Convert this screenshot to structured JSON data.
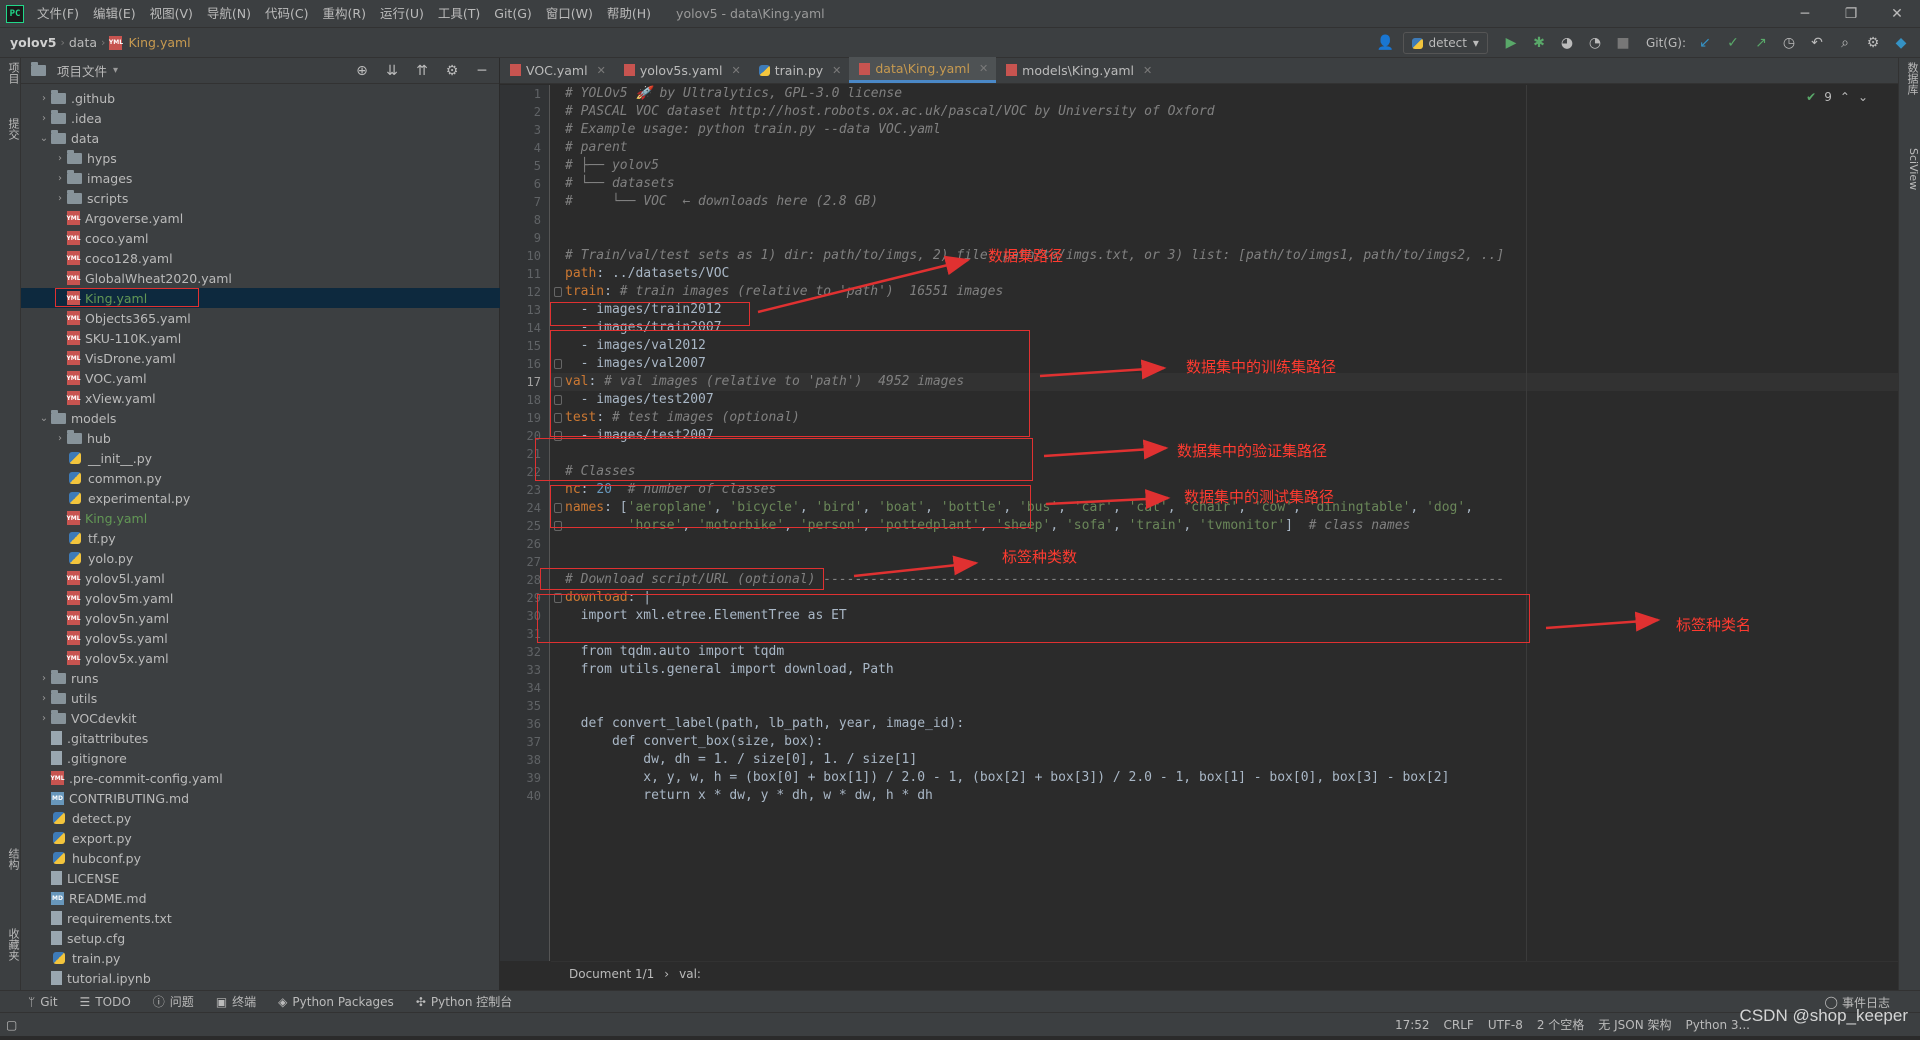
{
  "menu": {
    "logo": "PC",
    "items": [
      "文件(F)",
      "编辑(E)",
      "视图(V)",
      "导航(N)",
      "代码(C)",
      "重构(R)",
      "运行(U)",
      "工具(T)",
      "Git(G)",
      "窗口(W)",
      "帮助(H)"
    ],
    "window_title": "yolov5 - data\\King.yaml"
  },
  "breadcrumbs": {
    "project": "yolov5",
    "folder": "data",
    "file": "King.yaml"
  },
  "toolbar": {
    "run_config": "detect",
    "git_label": "Git(G):"
  },
  "project_panel": {
    "title": "项目文件",
    "tree": [
      {
        "label": ".github",
        "type": "folder",
        "depth": 1,
        "arrow": "›"
      },
      {
        "label": ".idea",
        "type": "folder",
        "depth": 1,
        "arrow": "›"
      },
      {
        "label": "data",
        "type": "folder",
        "depth": 1,
        "arrow": "⌄"
      },
      {
        "label": "hyps",
        "type": "folder",
        "depth": 2,
        "arrow": "›"
      },
      {
        "label": "images",
        "type": "folder",
        "depth": 2,
        "arrow": "›"
      },
      {
        "label": "scripts",
        "type": "folder",
        "depth": 2,
        "arrow": "›"
      },
      {
        "label": "Argoverse.yaml",
        "type": "yaml",
        "depth": 2
      },
      {
        "label": "coco.yaml",
        "type": "yaml",
        "depth": 2
      },
      {
        "label": "coco128.yaml",
        "type": "yaml",
        "depth": 2
      },
      {
        "label": "GlobalWheat2020.yaml",
        "type": "yaml",
        "depth": 2
      },
      {
        "label": "King.yaml",
        "type": "yaml",
        "depth": 2,
        "selected": true,
        "green": true
      },
      {
        "label": "Objects365.yaml",
        "type": "yaml",
        "depth": 2
      },
      {
        "label": "SKU-110K.yaml",
        "type": "yaml",
        "depth": 2
      },
      {
        "label": "VisDrone.yaml",
        "type": "yaml",
        "depth": 2
      },
      {
        "label": "VOC.yaml",
        "type": "yaml",
        "depth": 2
      },
      {
        "label": "xView.yaml",
        "type": "yaml",
        "depth": 2
      },
      {
        "label": "models",
        "type": "folder",
        "depth": 1,
        "arrow": "⌄"
      },
      {
        "label": "hub",
        "type": "folder",
        "depth": 2,
        "arrow": "›"
      },
      {
        "label": "__init__.py",
        "type": "py",
        "depth": 2
      },
      {
        "label": "common.py",
        "type": "py",
        "depth": 2
      },
      {
        "label": "experimental.py",
        "type": "py",
        "depth": 2
      },
      {
        "label": "King.yaml",
        "type": "yaml",
        "depth": 2,
        "green": true
      },
      {
        "label": "tf.py",
        "type": "py",
        "depth": 2
      },
      {
        "label": "yolo.py",
        "type": "py",
        "depth": 2
      },
      {
        "label": "yolov5l.yaml",
        "type": "yaml",
        "depth": 2
      },
      {
        "label": "yolov5m.yaml",
        "type": "yaml",
        "depth": 2
      },
      {
        "label": "yolov5n.yaml",
        "type": "yaml",
        "depth": 2
      },
      {
        "label": "yolov5s.yaml",
        "type": "yaml",
        "depth": 2
      },
      {
        "label": "yolov5x.yaml",
        "type": "yaml",
        "depth": 2
      },
      {
        "label": "runs",
        "type": "folder",
        "depth": 1,
        "arrow": "›"
      },
      {
        "label": "utils",
        "type": "folder",
        "depth": 1,
        "arrow": "›"
      },
      {
        "label": "VOCdevkit",
        "type": "folder",
        "depth": 1,
        "arrow": "›"
      },
      {
        "label": ".gitattributes",
        "type": "text",
        "depth": 1
      },
      {
        "label": ".gitignore",
        "type": "text",
        "depth": 1
      },
      {
        "label": ".pre-commit-config.yaml",
        "type": "yaml",
        "depth": 1
      },
      {
        "label": "CONTRIBUTING.md",
        "type": "md",
        "depth": 1
      },
      {
        "label": "detect.py",
        "type": "py",
        "depth": 1
      },
      {
        "label": "export.py",
        "type": "py",
        "depth": 1
      },
      {
        "label": "hubconf.py",
        "type": "py",
        "depth": 1
      },
      {
        "label": "LICENSE",
        "type": "text",
        "depth": 1
      },
      {
        "label": "README.md",
        "type": "md",
        "depth": 1
      },
      {
        "label": "requirements.txt",
        "type": "text",
        "depth": 1
      },
      {
        "label": "setup.cfg",
        "type": "text",
        "depth": 1
      },
      {
        "label": "train.py",
        "type": "py",
        "depth": 1
      },
      {
        "label": "tutorial.ipynb",
        "type": "text",
        "depth": 1
      }
    ]
  },
  "tabs": [
    {
      "label": "VOC.yaml",
      "type": "yaml"
    },
    {
      "label": "yolov5s.yaml",
      "type": "yaml"
    },
    {
      "label": "train.py",
      "type": "py"
    },
    {
      "label": "data\\King.yaml",
      "type": "yaml",
      "active": true
    },
    {
      "label": "models\\King.yaml",
      "type": "yaml"
    }
  ],
  "editor": {
    "current_line": 17,
    "inspection_count": "9",
    "lines": [
      [
        [
          "c-com",
          "# YOLOv5 🚀 by Ultralytics, GPL-3.0 license"
        ]
      ],
      [
        [
          "c-com",
          "# PASCAL VOC dataset http://host.robots.ox.ac.uk/pascal/VOC by University of Oxford"
        ]
      ],
      [
        [
          "c-com",
          "# Example usage: python train.py --data VOC.yaml"
        ]
      ],
      [
        [
          "c-com",
          "# parent"
        ]
      ],
      [
        [
          "c-com",
          "# ├── yolov5"
        ]
      ],
      [
        [
          "c-com",
          "# └── datasets"
        ]
      ],
      [
        [
          "c-com",
          "#     └── VOC  ← downloads here (2.8 GB)"
        ]
      ],
      [],
      [],
      [
        [
          "c-com",
          "# Train/val/test sets as 1) dir: path/to/imgs, 2) file: path/to/imgs.txt, or 3) list: [path/to/imgs1, path/to/imgs2, ..]"
        ]
      ],
      [
        [
          "c-key",
          "path"
        ],
        [
          "c-plain",
          ": ../datasets/VOC"
        ]
      ],
      [
        [
          "c-key",
          "train"
        ],
        [
          "c-plain",
          ": "
        ],
        [
          "c-com",
          "# train images (relative to 'path')  16551 images"
        ]
      ],
      [
        [
          "c-plain",
          "  - images/train2012"
        ]
      ],
      [
        [
          "c-plain",
          "  - images/train2007"
        ]
      ],
      [
        [
          "c-plain",
          "  - images/val2012"
        ]
      ],
      [
        [
          "c-plain",
          "  - images/val2007"
        ]
      ],
      [
        [
          "c-key",
          "val"
        ],
        [
          "c-plain",
          ": "
        ],
        [
          "c-com",
          "# val images (relative to 'path')  4952 images"
        ]
      ],
      [
        [
          "c-plain",
          "  - images/test2007"
        ]
      ],
      [
        [
          "c-key",
          "test"
        ],
        [
          "c-plain",
          ": "
        ],
        [
          "c-com",
          "# test images (optional)"
        ]
      ],
      [
        [
          "c-plain",
          "  - images/test2007"
        ]
      ],
      [],
      [
        [
          "c-com",
          "# Classes"
        ]
      ],
      [
        [
          "c-key",
          "nc"
        ],
        [
          "c-plain",
          ": "
        ],
        [
          "c-num",
          "20"
        ],
        [
          "c-plain",
          "  "
        ],
        [
          "c-com",
          "# number of classes"
        ]
      ],
      [
        [
          "c-key",
          "names"
        ],
        [
          "c-plain",
          ": ["
        ],
        [
          "c-str",
          "'aeroplane'"
        ],
        [
          "c-plain",
          ", "
        ],
        [
          "c-str",
          "'bicycle'"
        ],
        [
          "c-plain",
          ", "
        ],
        [
          "c-str",
          "'bird'"
        ],
        [
          "c-plain",
          ", "
        ],
        [
          "c-str",
          "'boat'"
        ],
        [
          "c-plain",
          ", "
        ],
        [
          "c-str",
          "'bottle'"
        ],
        [
          "c-plain",
          ", "
        ],
        [
          "c-str",
          "'bus'"
        ],
        [
          "c-plain",
          ", "
        ],
        [
          "c-str",
          "'car'"
        ],
        [
          "c-plain",
          ", "
        ],
        [
          "c-str",
          "'cat'"
        ],
        [
          "c-plain",
          ", "
        ],
        [
          "c-str",
          "'chair'"
        ],
        [
          "c-plain",
          ", "
        ],
        [
          "c-str",
          "'cow'"
        ],
        [
          "c-plain",
          ", "
        ],
        [
          "c-str",
          "'diningtable'"
        ],
        [
          "c-plain",
          ", "
        ],
        [
          "c-str",
          "'dog'"
        ],
        [
          "c-plain",
          ","
        ]
      ],
      [
        [
          "c-plain",
          "        "
        ],
        [
          "c-str",
          "'horse'"
        ],
        [
          "c-plain",
          ", "
        ],
        [
          "c-str",
          "'motorbike'"
        ],
        [
          "c-plain",
          ", "
        ],
        [
          "c-str",
          "'person'"
        ],
        [
          "c-plain",
          ", "
        ],
        [
          "c-str",
          "'pottedplant'"
        ],
        [
          "c-plain",
          ", "
        ],
        [
          "c-str",
          "'sheep'"
        ],
        [
          "c-plain",
          ", "
        ],
        [
          "c-str",
          "'sofa'"
        ],
        [
          "c-plain",
          ", "
        ],
        [
          "c-str",
          "'train'"
        ],
        [
          "c-plain",
          ", "
        ],
        [
          "c-str",
          "'tvmonitor'"
        ],
        [
          "c-plain",
          "]  "
        ],
        [
          "c-com",
          "# class names"
        ]
      ],
      [],
      [],
      [
        [
          "c-com",
          "# Download script/URL (optional) ---------------------------------------------------------------------------------------"
        ]
      ],
      [
        [
          "c-key",
          "download"
        ],
        [
          "c-plain",
          ": |"
        ]
      ],
      [
        [
          "c-plain",
          "  import xml.etree.ElementTree as ET"
        ]
      ],
      [],
      [
        [
          "c-plain",
          "  from tqdm.auto import tqdm"
        ]
      ],
      [
        [
          "c-plain",
          "  from utils.general import download, Path"
        ]
      ],
      [],
      [],
      [
        [
          "c-plain",
          "  def convert_label(path, lb_path, year, image_id):"
        ]
      ],
      [
        [
          "c-plain",
          "      def convert_box(size, box):"
        ]
      ],
      [
        [
          "c-plain",
          "          dw, dh = 1. / size[0], 1. / size[1]"
        ]
      ],
      [
        [
          "c-plain",
          "          x, y, w, h = (box[0] + box[1]) / 2.0 - 1, (box[2] + box[3]) / 2.0 - 1, box[1] - box[0], box[3] - box[2]"
        ]
      ],
      [
        [
          "c-plain",
          "          return x * dw, y * dh, w * dw, h * dh"
        ]
      ]
    ]
  },
  "editor_crumbs": {
    "doc": "Document 1/1",
    "sep": "›",
    "key": "val:"
  },
  "annotations": {
    "dataset_path": "数据集路径",
    "train_path": "数据集中的训练集路径",
    "val_path": "数据集中的验证集路径",
    "test_path": "数据集中的测试集路径",
    "nc": "标签种类数",
    "names": "标签种类名"
  },
  "bottom_tools": [
    "Git",
    "TODO",
    "问题",
    "终端",
    "Python Packages",
    "Python 控制台"
  ],
  "event_log": "事件日志",
  "status": {
    "position": "17:52",
    "line_sep": "CRLF",
    "encoding": "UTF-8",
    "indent": "2 个空格",
    "schema": "无 JSON 架构",
    "interpreter": "Python 3..."
  },
  "watermark": "CSDN @shop_keeper",
  "stripe": {
    "left_top": "项目",
    "left_mid": "提交",
    "left_structure": "结构",
    "left_fav": "收藏夹",
    "right_top": "数据库",
    "right_sci": "SciView"
  },
  "colors": {
    "annotation": "#e03131",
    "accent": "#4a88c7"
  }
}
